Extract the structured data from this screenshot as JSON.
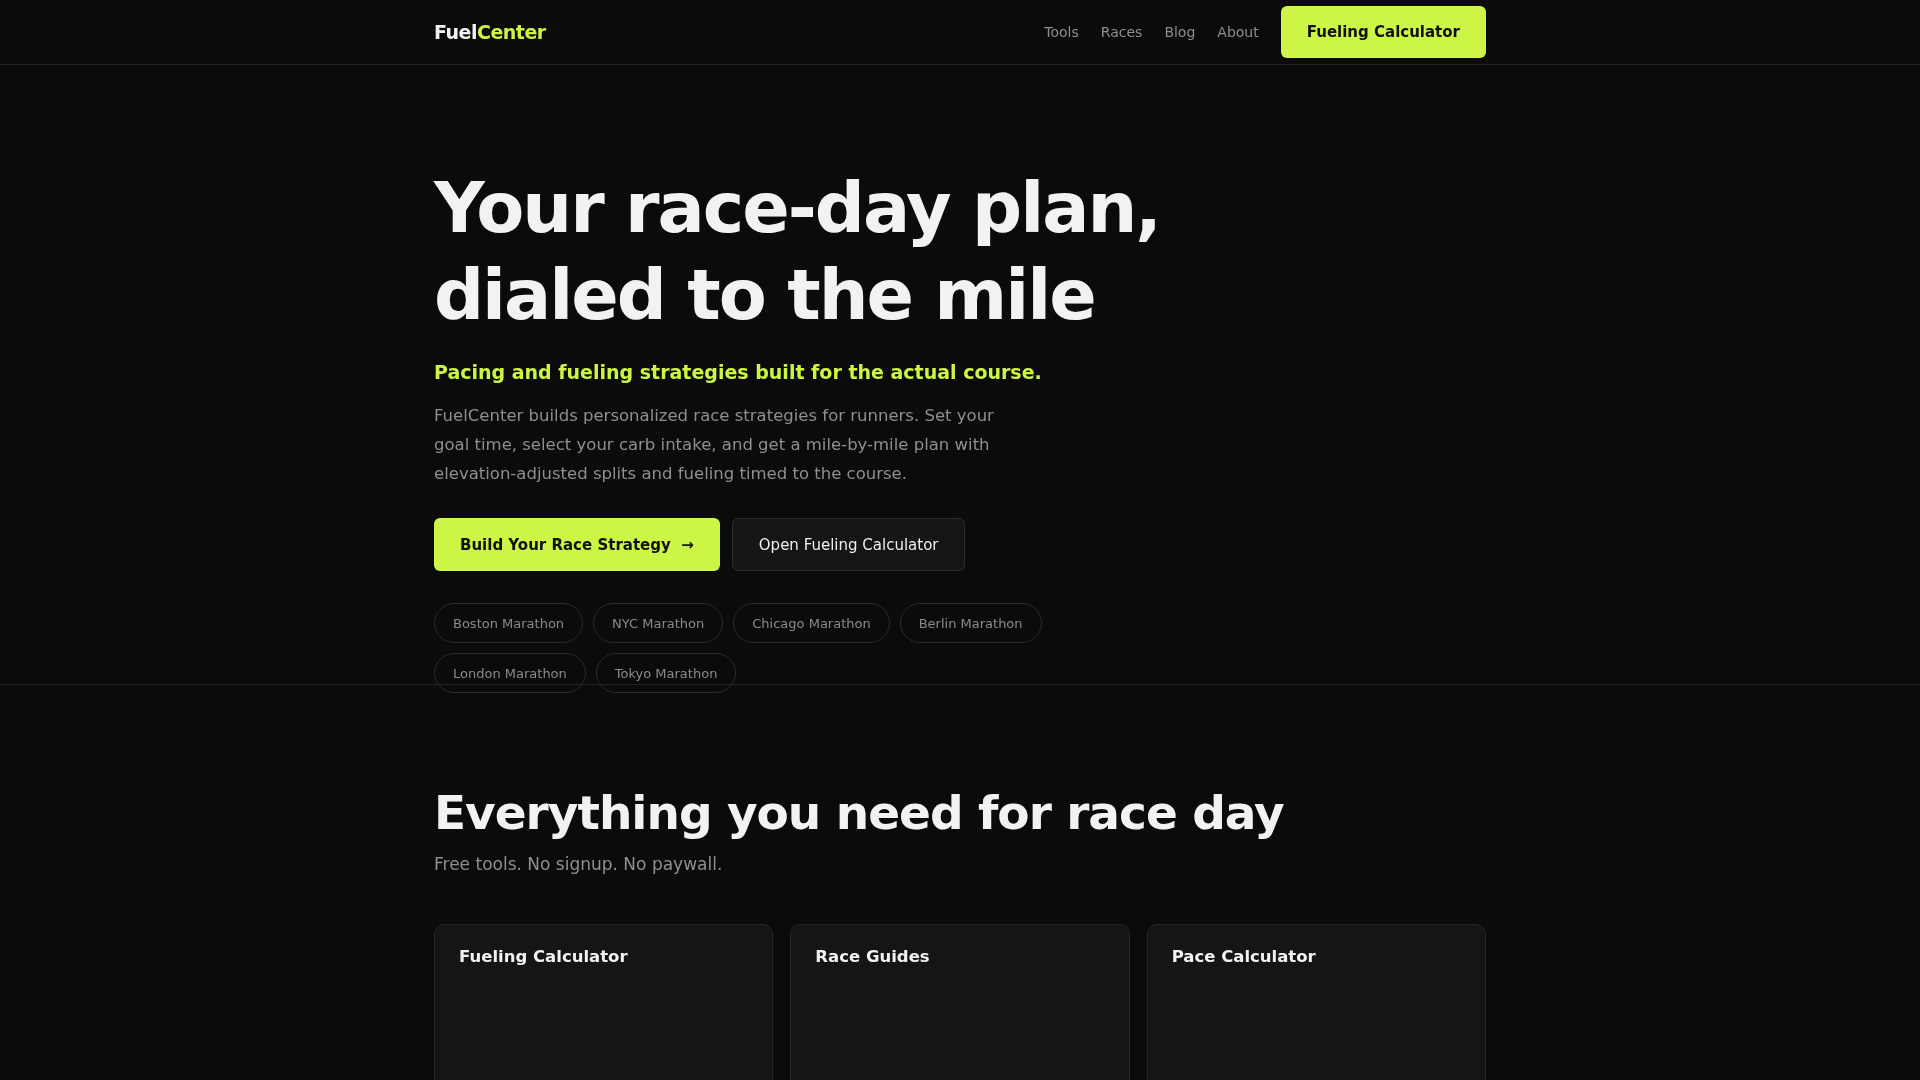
{
  "header": {
    "logo": {
      "first": "Fuel",
      "second": "Center"
    },
    "nav": [
      {
        "label": "Tools"
      },
      {
        "label": "Races"
      },
      {
        "label": "Blog"
      },
      {
        "label": "About"
      }
    ],
    "cta": "Fueling Calculator"
  },
  "hero": {
    "title_lines": [
      "Your race-day plan,",
      "dialed to the mile"
    ],
    "tagline": "Pacing and fueling strategies built for the actual course.",
    "description": "FuelCenter builds personalized race strategies for runners. Set your goal time, select your carb intake, and get a mile-by-mile plan with elevation-adjusted splits and fueling timed to the course.",
    "buttons": [
      {
        "kind": "primary",
        "label": "Build Your Race Strategy",
        "arrow": "→"
      },
      {
        "kind": "secondary",
        "label": "Open Fueling Calculator"
      }
    ],
    "races": [
      "Boston Marathon",
      "NYC Marathon",
      "Chicago Marathon",
      "Berlin Marathon",
      "London Marathon",
      "Tokyo Marathon"
    ]
  },
  "features": {
    "title": "Everything you need for race day",
    "subtitle": "Free tools. No signup. No paywall.",
    "cards": [
      {
        "title": "Fueling Calculator"
      },
      {
        "title": "Race Guides"
      },
      {
        "title": "Pace Calculator"
      }
    ]
  }
}
